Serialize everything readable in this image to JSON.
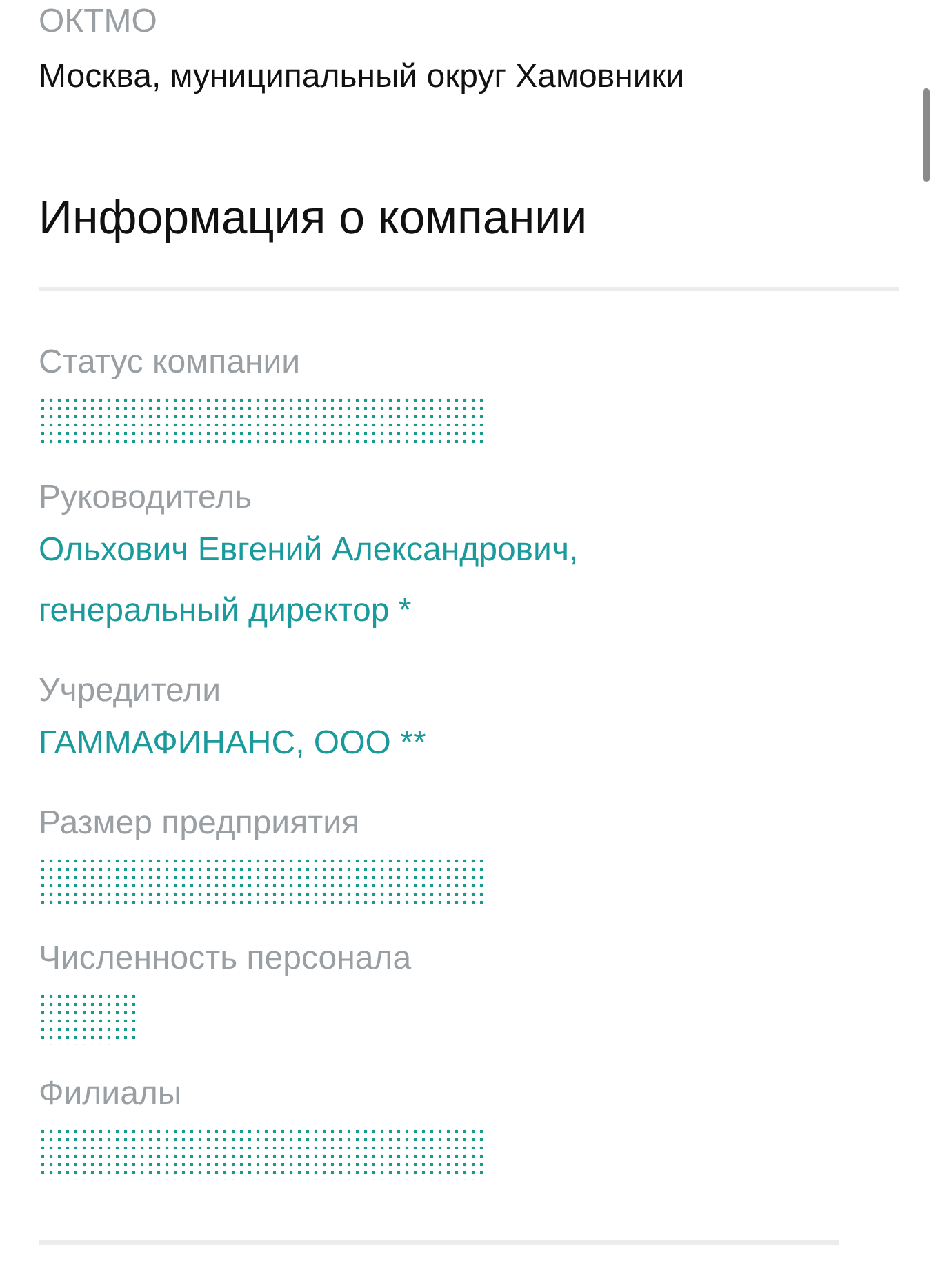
{
  "address": {
    "label": "ОКТМО",
    "value": "Москва, муниципальный округ Хамовники"
  },
  "company_info": {
    "title": "Информация о компании",
    "fields": [
      {
        "label": "Статус компании",
        "kind": "hidden"
      },
      {
        "label": "Руководитель",
        "kind": "link",
        "lines": [
          "Ольхович Евгений Александрович,",
          "генеральный директор *"
        ]
      },
      {
        "label": "Учредители",
        "kind": "link",
        "lines": [
          "ГАММАФИНАНС, ООО **"
        ]
      },
      {
        "label": "Размер предприятия",
        "kind": "hidden"
      },
      {
        "label": "Численность персонала",
        "kind": "hiddenshort"
      },
      {
        "label": "Филиалы",
        "kind": "hidden"
      }
    ]
  }
}
